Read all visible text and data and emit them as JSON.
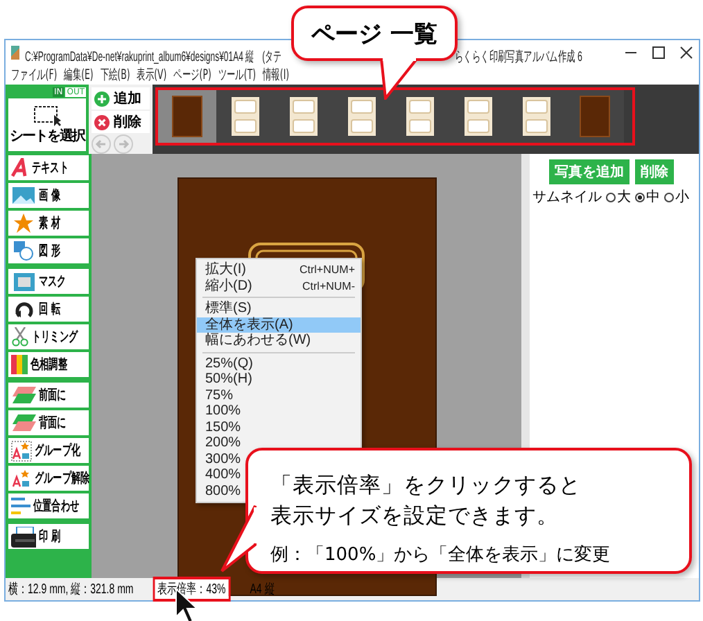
{
  "window": {
    "title": "C:¥ProgramData¥De-net¥rakuprint_album6¥designs¥01A4 縦　(タテ",
    "app_title": "らくらく印刷写真アルバム作成 6"
  },
  "menu": [
    "ファイル(F)",
    "編集(E)",
    "下絵(B)",
    "表示(V)",
    "ページ(P)",
    "ツール(T)",
    "情報(I)"
  ],
  "mode_toggle": [
    {
      "label": "IN",
      "selected": false
    },
    {
      "label": "OUT",
      "selected": true
    }
  ],
  "select_sheet": {
    "label": "シートを選択"
  },
  "page_buttons": [
    {
      "kind": "add",
      "label": "追加"
    },
    {
      "kind": "delete",
      "label": "削除"
    }
  ],
  "pages": [
    {
      "kind": "cover",
      "selected": true
    },
    {
      "kind": "layout",
      "selected": false
    },
    {
      "kind": "layout",
      "selected": false
    },
    {
      "kind": "layout",
      "selected": false
    },
    {
      "kind": "layout",
      "selected": false
    },
    {
      "kind": "layout",
      "selected": false
    },
    {
      "kind": "layout",
      "selected": false
    },
    {
      "kind": "cover",
      "selected": false
    }
  ],
  "tool_groups": [
    [
      {
        "kind": "text",
        "label": "テキスト"
      },
      {
        "kind": "image",
        "label": "画 像"
      },
      {
        "kind": "star",
        "label": "素 材"
      },
      {
        "kind": "shape",
        "label": "図 形"
      }
    ],
    [
      {
        "kind": "mask",
        "label": "マスク"
      },
      {
        "kind": "rotate",
        "label": "回 転"
      },
      {
        "kind": "trim",
        "label": "トリミング"
      },
      {
        "kind": "hue",
        "label": "色相調整"
      }
    ],
    [
      {
        "kind": "front",
        "label": "前面に"
      },
      {
        "kind": "back",
        "label": "背面に"
      },
      {
        "kind": "group",
        "label": "グループ化"
      },
      {
        "kind": "ungroup",
        "label": "グループ解除"
      },
      {
        "kind": "align",
        "label": "位置合わせ"
      }
    ],
    [
      {
        "kind": "print",
        "label": "印 刷"
      }
    ]
  ],
  "zoom_menu": [
    {
      "label": "拡大(I)",
      "shortcut": "Ctrl+NUM+",
      "selected": false
    },
    {
      "label": "縮小(D)",
      "shortcut": "Ctrl+NUM-",
      "selected": false
    },
    {
      "kind": "separator"
    },
    {
      "label": "標準(S)",
      "selected": false
    },
    {
      "label": "全体を表示(A)",
      "selected": true
    },
    {
      "label": "幅にあわせる(W)",
      "selected": false
    },
    {
      "kind": "separator"
    },
    {
      "label": "25%(Q)",
      "selected": false
    },
    {
      "label": "50%(H)",
      "selected": false
    },
    {
      "label": "75%",
      "selected": false
    },
    {
      "label": "100%",
      "selected": false
    },
    {
      "label": "150%",
      "selected": false
    },
    {
      "label": "200%",
      "selected": false
    },
    {
      "label": "300%",
      "selected": false
    },
    {
      "label": "400%",
      "selected": false
    },
    {
      "label": "800%",
      "selected": false
    }
  ],
  "right_panel": {
    "buttons": [
      "写真を追加",
      "削除"
    ],
    "thumbnail_label": "サムネイル",
    "sizes": [
      {
        "label": "大",
        "selected": false
      },
      {
        "label": "中",
        "selected": true
      },
      {
        "label": "小",
        "selected": false
      }
    ]
  },
  "status_bar": {
    "position": "横：12.9 mm, 縦：321.8 mm",
    "zoom": "表示倍率：43%",
    "paper": "A4 縦"
  },
  "callouts": [
    {
      "lines": [
        "ページ 一覧"
      ]
    },
    {
      "lines": [
        "「表示倍率」をクリックすると",
        "表示サイズを設定できます。"
      ],
      "note": "例：「100%」から「全体を表示」に変更"
    }
  ]
}
